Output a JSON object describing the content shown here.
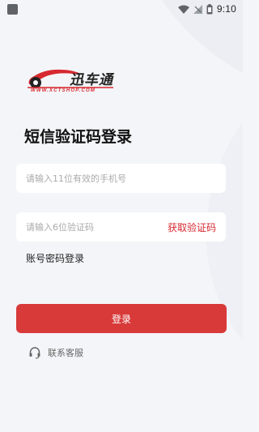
{
  "status_bar": {
    "time": "9:10",
    "icons": [
      "notification-square-icon",
      "wifi-icon",
      "signal-icon",
      "battery-icon"
    ]
  },
  "logo": {
    "text": "迅车通",
    "url": "WWW.XCTSHOP.COM"
  },
  "page": {
    "title": "短信验证码登录"
  },
  "form": {
    "phone": {
      "placeholder": "请输入11位有效的手机号",
      "value": ""
    },
    "code": {
      "placeholder": "请输入6位验证码",
      "value": ""
    },
    "get_code_label": "获取验证码",
    "account_login_label": "账号密码登录",
    "login_label": "登录"
  },
  "contact": {
    "label": "联系客服",
    "icon": "headset-icon"
  },
  "colors": {
    "accent": "#d83a3a",
    "brand_red": "#d7282f",
    "background": "#f4f5f8"
  }
}
